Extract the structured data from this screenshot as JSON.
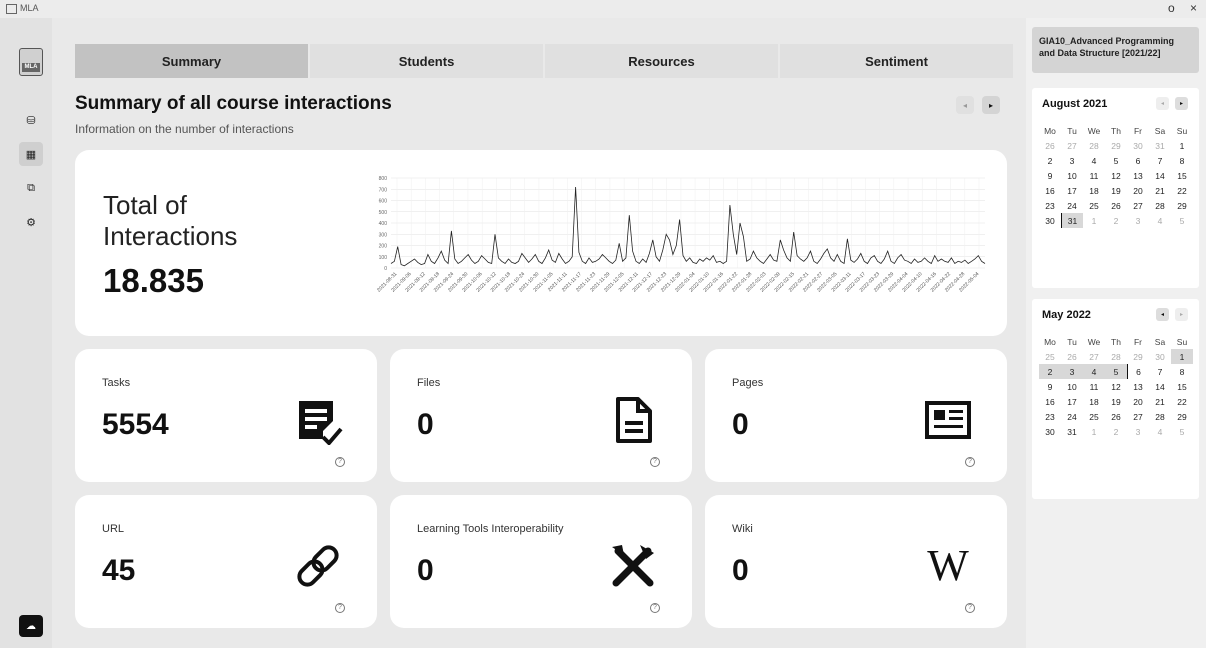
{
  "window": {
    "title": "MLA",
    "minimize_glyph": "o",
    "close_glyph": "×"
  },
  "sidebar": {
    "logo_text": "MLA",
    "items": [
      {
        "name": "database-icon",
        "glyph": "⛁",
        "active": false
      },
      {
        "name": "dashboard-icon",
        "glyph": "▦",
        "active": true
      },
      {
        "name": "add-display-icon",
        "glyph": "⧉",
        "active": false
      },
      {
        "name": "settings-icon",
        "glyph": "⚙",
        "active": false
      }
    ],
    "bottom_glyph": "☁"
  },
  "tabs": [
    {
      "label": "Summary",
      "active": true
    },
    {
      "label": "Students",
      "active": false
    },
    {
      "label": "Resources",
      "active": false
    },
    {
      "label": "Sentiment",
      "active": false
    }
  ],
  "header": {
    "title": "Summary of all course interactions",
    "subtitle": "Information on the number of interactions",
    "prev_glyph": "◂",
    "next_glyph": "▸"
  },
  "total": {
    "label": "Total of Interactions",
    "value": "18.835"
  },
  "chart_data": {
    "type": "line",
    "ylim": [
      0,
      800
    ],
    "y_ticks": [
      "0",
      "100",
      "200",
      "300",
      "400",
      "500",
      "600",
      "700",
      "800"
    ],
    "grid": true,
    "x_tick_labels": [
      "2021-08-31",
      "2021-09-06",
      "2021-09-12",
      "2021-09-18",
      "2021-09-24",
      "2021-09-30",
      "2021-10-06",
      "2021-10-12",
      "2021-10-18",
      "2021-10-24",
      "2021-10-30",
      "2021-11-05",
      "2021-11-11",
      "2021-11-17",
      "2021-11-23",
      "2021-11-29",
      "2021-12-05",
      "2021-12-11",
      "2021-12-17",
      "2021-12-23",
      "2021-12-29",
      "2022-01-04",
      "2022-01-10",
      "2022-01-16",
      "2022-01-22",
      "2022-01-28",
      "2022-02-03",
      "2022-02-09",
      "2022-02-15",
      "2022-02-21",
      "2022-02-27",
      "2022-03-05",
      "2022-03-11",
      "2022-03-17",
      "2022-03-23",
      "2022-03-29",
      "2022-04-04",
      "2022-04-10",
      "2022-04-16",
      "2022-04-22",
      "2022-04-28",
      "2022-05-04"
    ],
    "series": [
      {
        "values": [
          40,
          60,
          190,
          30,
          20,
          40,
          60,
          80,
          50,
          30,
          40,
          120,
          60,
          40,
          90,
          150,
          70,
          40,
          330,
          80,
          40,
          60,
          90,
          120,
          70,
          40,
          60,
          110,
          80,
          50,
          40,
          300,
          90,
          60,
          40,
          80,
          50,
          40,
          60,
          130,
          90,
          50,
          80,
          120,
          60,
          40,
          90,
          160,
          70,
          50,
          130,
          80,
          40,
          60,
          100,
          720,
          140,
          60,
          40,
          90,
          50,
          60,
          80,
          120,
          90,
          60,
          40,
          70,
          220,
          60,
          90,
          470,
          150,
          60,
          40,
          80,
          50,
          130,
          250,
          100,
          60,
          160,
          300,
          250,
          120,
          200,
          430,
          110,
          60,
          90,
          50,
          40,
          80,
          60,
          90,
          70,
          110,
          50,
          60,
          40,
          60,
          560,
          300,
          120,
          400,
          280,
          60,
          80,
          150,
          90,
          60,
          40,
          80,
          120,
          70,
          60,
          250,
          160,
          90,
          60,
          320,
          110,
          80,
          60,
          90,
          150,
          60,
          40,
          80,
          130,
          170,
          90,
          60,
          120,
          60,
          40,
          260,
          70,
          50,
          80,
          130,
          60,
          40,
          90,
          110,
          60,
          40,
          80,
          150,
          60,
          40,
          90,
          120,
          70,
          60,
          40,
          80,
          50,
          60,
          90,
          60,
          40,
          110,
          60,
          80,
          60,
          50,
          90,
          40,
          60,
          50,
          70,
          40,
          60,
          80,
          110,
          60,
          40
        ]
      }
    ]
  },
  "metrics": [
    {
      "label": "Tasks",
      "value": "5554",
      "icon": "task-icon"
    },
    {
      "label": "Files",
      "value": "0",
      "icon": "file-icon"
    },
    {
      "label": "Pages",
      "value": "0",
      "icon": "page-icon"
    },
    {
      "label": "URL",
      "value": "45",
      "icon": "link-icon"
    },
    {
      "label": "Learning Tools Interoperability",
      "value": "0",
      "icon": "tools-icon"
    },
    {
      "label": "Wiki",
      "value": "0",
      "icon": "wiki-icon",
      "glyph": "W"
    }
  ],
  "help_glyph": "?",
  "right_panel": {
    "course": "GIA10_Advanced Programming and Data Structure [2021/22]",
    "weekdays": [
      "Mo",
      "Tu",
      "We",
      "Th",
      "Fr",
      "Sa",
      "Su"
    ],
    "calendars": [
      {
        "title": "August 2021",
        "days": [
          [
            "26",
            "27",
            "28",
            "29",
            "30",
            "31",
            "1"
          ],
          [
            "2",
            "3",
            "4",
            "5",
            "6",
            "7",
            "8"
          ],
          [
            "9",
            "10",
            "11",
            "12",
            "13",
            "14",
            "15"
          ],
          [
            "16",
            "17",
            "18",
            "19",
            "20",
            "21",
            "22"
          ],
          [
            "23",
            "24",
            "25",
            "26",
            "27",
            "28",
            "29"
          ],
          [
            "30",
            "31",
            "1",
            "2",
            "3",
            "4",
            "5"
          ]
        ],
        "muted_rows": [
          [
            0,
            1,
            2,
            3,
            4,
            5
          ],
          [],
          [],
          [],
          [],
          [
            2,
            3,
            4,
            5,
            6
          ]
        ],
        "selected": [
          [
            5,
            1
          ]
        ],
        "today": [
          [
            5,
            1
          ]
        ]
      },
      {
        "title": "May 2022",
        "days": [
          [
            "25",
            "26",
            "27",
            "28",
            "29",
            "30",
            "1"
          ],
          [
            "2",
            "3",
            "4",
            "5",
            "6",
            "7",
            "8"
          ],
          [
            "9",
            "10",
            "11",
            "12",
            "13",
            "14",
            "15"
          ],
          [
            "16",
            "17",
            "18",
            "19",
            "20",
            "21",
            "22"
          ],
          [
            "23",
            "24",
            "25",
            "26",
            "27",
            "28",
            "29"
          ],
          [
            "30",
            "31",
            "1",
            "2",
            "3",
            "4",
            "5"
          ]
        ],
        "muted_rows": [
          [
            0,
            1,
            2,
            3,
            4,
            5
          ],
          [],
          [],
          [],
          [],
          [
            2,
            3,
            4,
            5,
            6
          ]
        ],
        "selected": [
          [
            0,
            6
          ],
          [
            1,
            0
          ],
          [
            1,
            1
          ],
          [
            1,
            2
          ],
          [
            1,
            3
          ]
        ],
        "today": [
          [
            1,
            4
          ]
        ]
      }
    ]
  }
}
